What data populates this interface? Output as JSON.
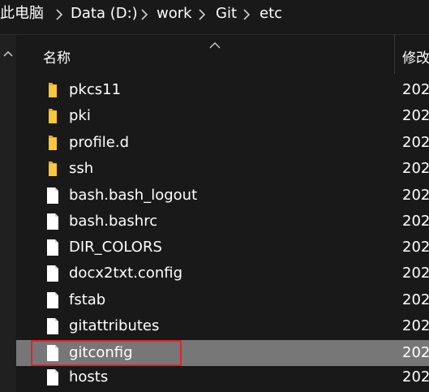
{
  "breadcrumb": {
    "items": [
      "此电脑",
      "Data (D:)",
      "work",
      "Git",
      "etc"
    ]
  },
  "columns": {
    "name_label": "名称",
    "date_label": "修改"
  },
  "files": [
    {
      "name": "pkcs11",
      "type": "folder",
      "date": "202"
    },
    {
      "name": "pki",
      "type": "folder",
      "date": "202"
    },
    {
      "name": "profile.d",
      "type": "folder",
      "date": "202"
    },
    {
      "name": "ssh",
      "type": "folder",
      "date": "202"
    },
    {
      "name": "bash.bash_logout",
      "type": "file",
      "date": "202"
    },
    {
      "name": "bash.bashrc",
      "type": "file",
      "date": "202"
    },
    {
      "name": "DIR_COLORS",
      "type": "file",
      "date": "202"
    },
    {
      "name": "docx2txt.config",
      "type": "file",
      "date": "202"
    },
    {
      "name": "fstab",
      "type": "file",
      "date": "202"
    },
    {
      "name": "gitattributes",
      "type": "file",
      "date": "202"
    },
    {
      "name": "gitconfig",
      "type": "file",
      "date": "202",
      "selected": true
    },
    {
      "name": "hosts",
      "type": "file",
      "date": "202"
    }
  ],
  "icons": {
    "folder": "folder-icon",
    "file": "file-icon"
  },
  "colors": {
    "background": "#191919",
    "selection": "#777777",
    "highlight": "#e3242b",
    "folder": "#f8c83a"
  }
}
